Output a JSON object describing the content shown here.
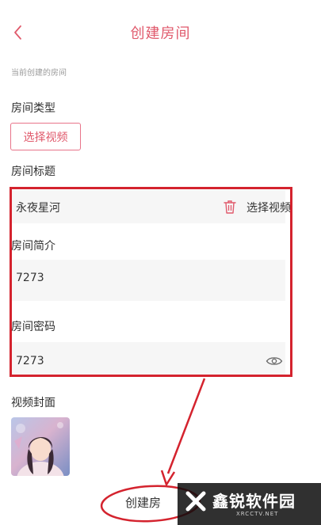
{
  "header": {
    "title": "创建房间"
  },
  "hint": "当前创建的房间",
  "room_type": {
    "label": "房间类型",
    "select_video_button": "选择视频"
  },
  "room_title": {
    "label": "房间标题",
    "value": "永夜星河",
    "select_video_label": "选择视频"
  },
  "room_intro": {
    "label": "房间简介",
    "value": "7273"
  },
  "room_password": {
    "label": "房间密码",
    "value": "7273"
  },
  "cover": {
    "label": "视频封面"
  },
  "create_button": "创建房",
  "watermark": {
    "brand": "鑫锐软件园",
    "url": "XRCCTV.NET"
  },
  "colors": {
    "accent": "#e05a6c",
    "annotation": "#d4232e"
  }
}
